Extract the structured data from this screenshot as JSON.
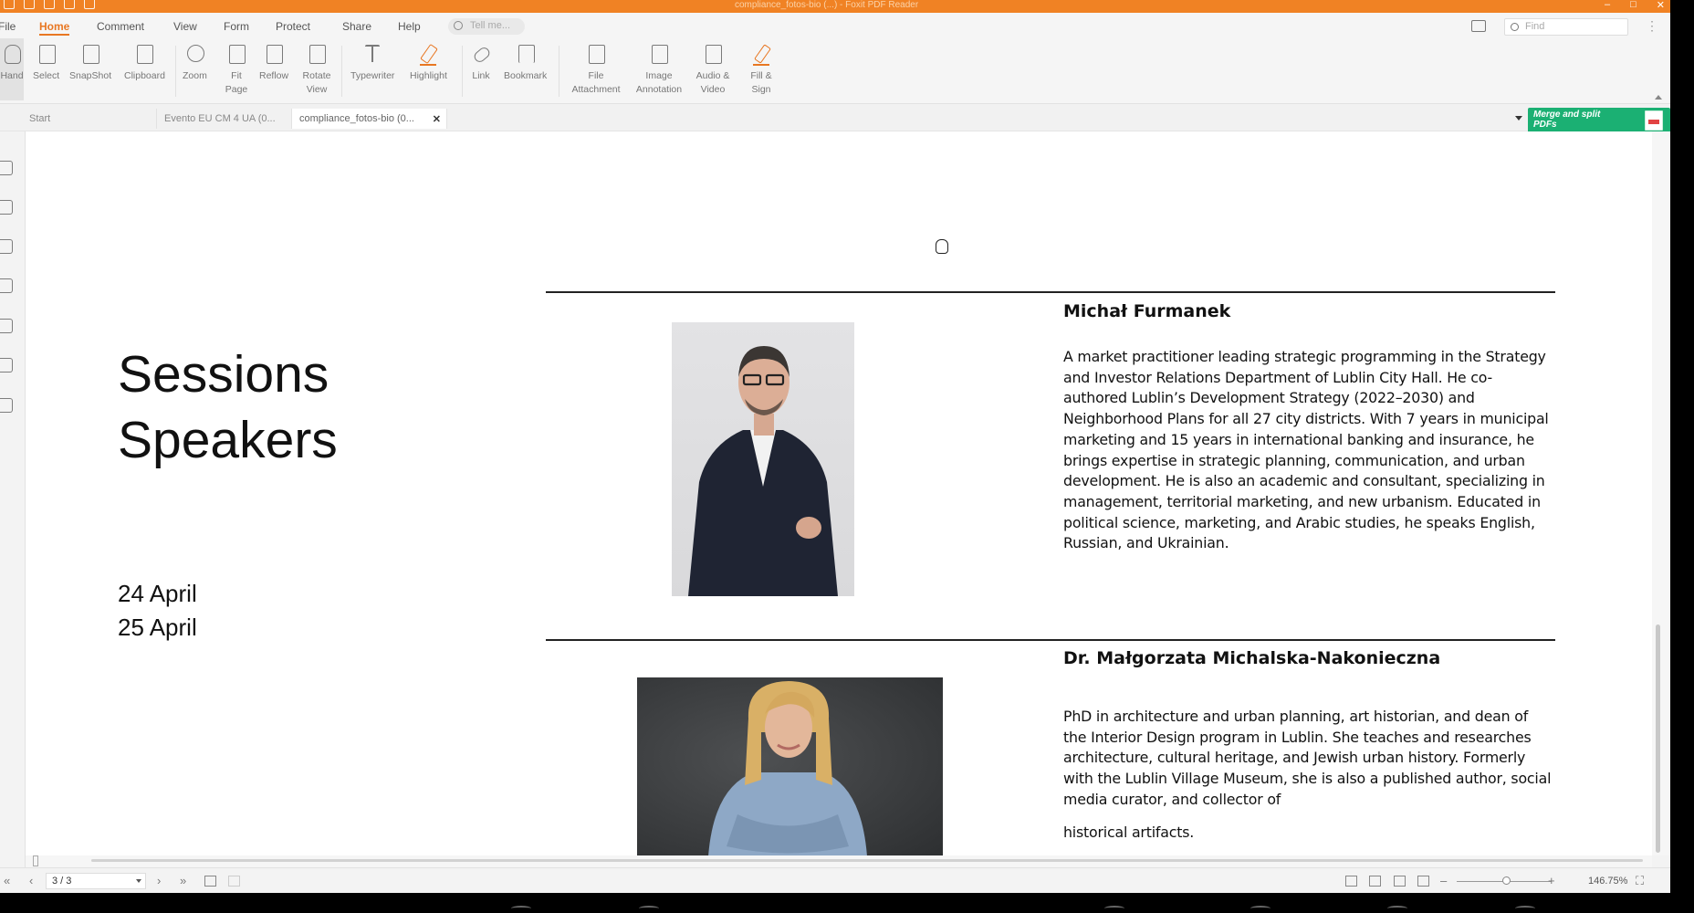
{
  "window": {
    "title": "compliance_fotos-bio (...) - Foxit PDF Reader"
  },
  "menu": [
    "File",
    "Home",
    "Comment",
    "View",
    "Form",
    "Protect",
    "Share",
    "Help"
  ],
  "active_menu": "Home",
  "tellme_placeholder": "Tell me...",
  "find_placeholder": "Find",
  "ribbon": [
    {
      "id": "hand",
      "label": "Hand",
      "icon": "hand-icon"
    },
    {
      "id": "select",
      "label": "Select",
      "icon": "select-text-icon"
    },
    {
      "id": "snapshot",
      "label": "SnapShot",
      "icon": "snapshot-icon"
    },
    {
      "id": "clipboard",
      "label": "Clipboard",
      "icon": "clipboard-icon"
    },
    {
      "id": "zoom",
      "label": "Zoom",
      "icon": "zoom-icon"
    },
    {
      "id": "fitpage",
      "label": "Fit Page",
      "icon": "fit-page-icon"
    },
    {
      "id": "reflow",
      "label": "Reflow",
      "icon": "reflow-icon"
    },
    {
      "id": "rotate",
      "label": "Rotate View",
      "icon": "rotate-view-icon"
    },
    {
      "id": "typewriter",
      "label": "Typewriter",
      "icon": "typewriter-icon"
    },
    {
      "id": "highlight",
      "label": "Highlight",
      "icon": "highlight-icon"
    },
    {
      "id": "link",
      "label": "Link",
      "icon": "link-icon"
    },
    {
      "id": "bookmark",
      "label": "Bookmark",
      "icon": "bookmark-icon"
    },
    {
      "id": "fileattach",
      "label": "File Attachment",
      "icon": "file-attachment-icon"
    },
    {
      "id": "imageannot",
      "label": "Image Annotation",
      "icon": "image-annotation-icon"
    },
    {
      "id": "audiovideo",
      "label": "Audio & Video",
      "icon": "audio-video-icon"
    },
    {
      "id": "fillsign",
      "label": "Fill & Sign",
      "icon": "fill-sign-icon"
    }
  ],
  "tabs": [
    {
      "label": "Start",
      "active": false
    },
    {
      "label": "Evento EU CM 4 UA (0...",
      "active": false
    },
    {
      "label": "compliance_fotos-bio (0...",
      "active": true
    }
  ],
  "promo": {
    "text": "Merge and split PDFs"
  },
  "document": {
    "heading": [
      "Sessions",
      "Speakers"
    ],
    "dates": [
      "24 April",
      "25 April"
    ],
    "speakers": [
      {
        "name": "Michał Furmanek",
        "bio": "A market practitioner leading strategic programming in the Strategy and Investor Relations Department of Lublin City Hall. He co-authored Lublin’s Development Strategy (2022–2030) and Neighborhood Plans for all 27 city districts. With 7 years in municipal marketing and 15 years in international banking and insurance, he brings expertise in strategic planning, communication, and urban development. He is also an academic and consultant, specializing in management, territorial marketing, and new urbanism. Educated in political science, marketing, and Arabic studies, he speaks English, Russian, and Ukrainian."
      },
      {
        "name": "Dr. Małgorzata Michalska-Nakonieczna",
        "bio": "PhD in architecture and urban planning, art historian, and dean of the Interior Design program in Lublin. She teaches and researches architecture, cultural heritage, and Jewish urban history. Formerly with the Lublin Village Museum, she is also a published author, social media curator, and collector of",
        "bio_tail": "historical artifacts."
      }
    ]
  },
  "status": {
    "page": "3 / 3",
    "zoom": "146.75%"
  },
  "colors": {
    "accent": "#f08224",
    "promo": "#1bb073"
  }
}
